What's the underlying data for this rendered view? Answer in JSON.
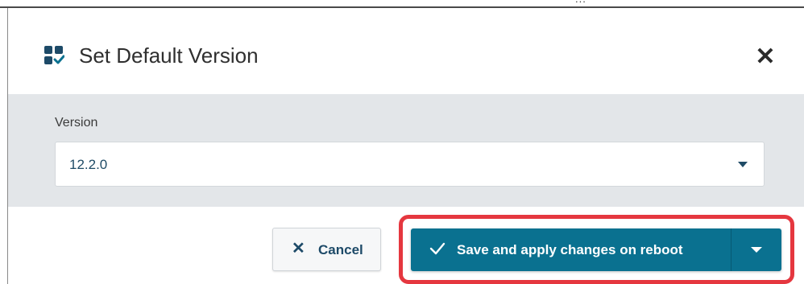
{
  "background_text": "...",
  "dialog": {
    "title": "Set Default Version",
    "title_icon": "dashboard-check-icon",
    "close_icon": "close-icon",
    "close_glyph": "✕"
  },
  "form": {
    "version_label": "Version",
    "version_value": "12.2.0",
    "version_caret_icon": "caret-down-icon"
  },
  "footer": {
    "cancel_glyph": "✕",
    "cancel_icon": "close-icon",
    "cancel_label": "Cancel",
    "save_icon": "check-icon",
    "save_label": "Save and apply changes on reboot",
    "dropdown_icon": "caret-down-icon"
  },
  "colors": {
    "primary": "#0a7190",
    "highlight": "#e5373f",
    "body_bg": "#e3e6e9",
    "text_accent": "#1d4a68"
  }
}
